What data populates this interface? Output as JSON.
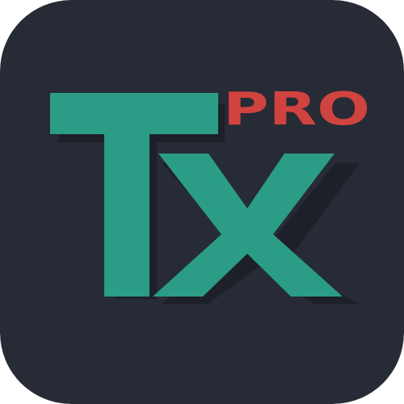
{
  "logo": {
    "text": "Tx",
    "badge": "PRO"
  },
  "colors": {
    "background": "#272b35",
    "shadow": "#1b1e25",
    "letters": "#2b9d86",
    "badge": "#d1433f"
  }
}
